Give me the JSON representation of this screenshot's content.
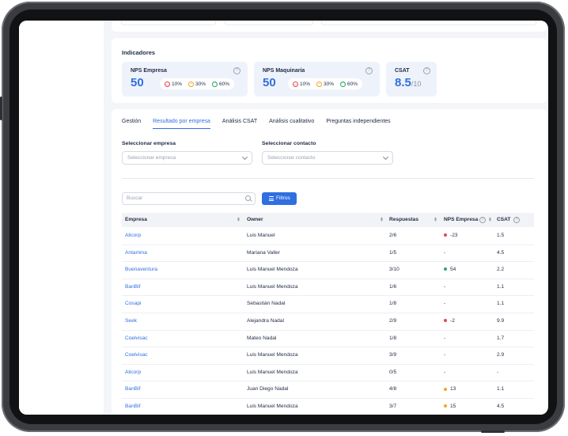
{
  "indicadores": {
    "title": "Indicadores",
    "cards": [
      {
        "label": "NPS Empresa",
        "value": "50",
        "chips": [
          "10%",
          "30%",
          "60%"
        ]
      },
      {
        "label": "NPS Maquinaria",
        "value": "50",
        "chips": [
          "10%",
          "30%",
          "60%"
        ]
      },
      {
        "label": "CSAT",
        "value": "8.5",
        "suffix": "/10"
      }
    ]
  },
  "tabs": [
    "Gestión",
    "Resultado por empresa",
    "Análisis CSAT",
    "Análisis cualitativo",
    "Preguntas independientes"
  ],
  "filters": {
    "empresa_label": "Seleccionar empresa",
    "empresa_placeholder": "Seleccionar empresa",
    "contacto_label": "Seleccionar contacto",
    "contacto_placeholder": "Seleccionar contacto"
  },
  "search": {
    "placeholder": "Buscar"
  },
  "filter_button": "Filtros",
  "table": {
    "headers": [
      "Empresa",
      "Owner",
      "Respuestas",
      "NPS Empresa",
      "CSAT"
    ],
    "rows": [
      {
        "empresa": "Alicorp",
        "owner": "Luis Manuel",
        "respuestas": "2/6",
        "nps": "-23",
        "nps_status": "red",
        "csat": "1.5"
      },
      {
        "empresa": "Antamina",
        "owner": "Mariana Valler",
        "respuestas": "1/5",
        "nps": "-",
        "nps_status": "none",
        "csat": "4.5"
      },
      {
        "empresa": "Buenaventura",
        "owner": "Luis Manuel Mendoza",
        "respuestas": "3/10",
        "nps": "54",
        "nps_status": "green",
        "csat": "2.2"
      },
      {
        "empresa": "BanBif",
        "owner": "Luis Manuel Mendoza",
        "respuestas": "1/6",
        "nps": "-",
        "nps_status": "none",
        "csat": "1.1"
      },
      {
        "empresa": "Cosapi",
        "owner": "Sebastián Nadal",
        "respuestas": "1/8",
        "nps": "-",
        "nps_status": "none",
        "csat": "1.1"
      },
      {
        "empresa": "Seek",
        "owner": "Alejandra Nadal",
        "respuestas": "2/9",
        "nps": "-2",
        "nps_status": "red",
        "csat": "9.9"
      },
      {
        "empresa": "Coelvisac",
        "owner": "Mateo Nadal",
        "respuestas": "1/8",
        "nps": "-",
        "nps_status": "none",
        "csat": "1.7"
      },
      {
        "empresa": "Coelvisac",
        "owner": "Luis Manuel Mendoza",
        "respuestas": "3/9",
        "nps": "-",
        "nps_status": "none",
        "csat": "2.9"
      },
      {
        "empresa": "Alicorp",
        "owner": "Luis Manuel Mendoza",
        "respuestas": "0/5",
        "nps": "-",
        "nps_status": "none",
        "csat": "-"
      },
      {
        "empresa": "BanBif",
        "owner": "Juan Diego Nadal",
        "respuestas": "4/8",
        "nps": "13",
        "nps_status": "yellow",
        "csat": "1.1"
      },
      {
        "empresa": "BanBif",
        "owner": "Luis Manuel Mendoza",
        "respuestas": "3/7",
        "nps": "15",
        "nps_status": "yellow",
        "csat": "4.5"
      }
    ]
  },
  "colors": {
    "accent": "#2f6fe0",
    "red": "#e5484d",
    "green": "#30a46c",
    "yellow": "#f5a524"
  }
}
